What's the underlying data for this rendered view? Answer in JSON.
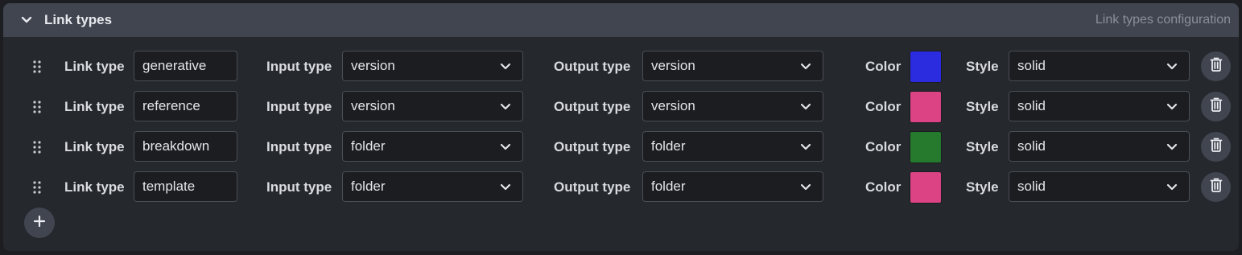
{
  "section": {
    "title": "Link types",
    "subtitle": "Link types configuration"
  },
  "labels": {
    "link_type": "Link type",
    "input_type": "Input type",
    "output_type": "Output type",
    "color": "Color",
    "style": "Style"
  },
  "rows": [
    {
      "link_type": "generative",
      "input_type": "version",
      "output_type": "version",
      "color": "#2b2be0",
      "style": "solid"
    },
    {
      "link_type": "reference",
      "input_type": "version",
      "output_type": "version",
      "color": "#db4385",
      "style": "solid"
    },
    {
      "link_type": "breakdown",
      "input_type": "folder",
      "output_type": "folder",
      "color": "#257a2e",
      "style": "solid"
    },
    {
      "link_type": "template",
      "input_type": "folder",
      "output_type": "folder",
      "color": "#db4385",
      "style": "solid"
    }
  ],
  "icons": {
    "collapse": "chevron-down-icon",
    "drag": "drag-handle-icon",
    "dropdown": "chevron-down-icon",
    "delete": "trash-icon",
    "add": "plus-icon"
  }
}
